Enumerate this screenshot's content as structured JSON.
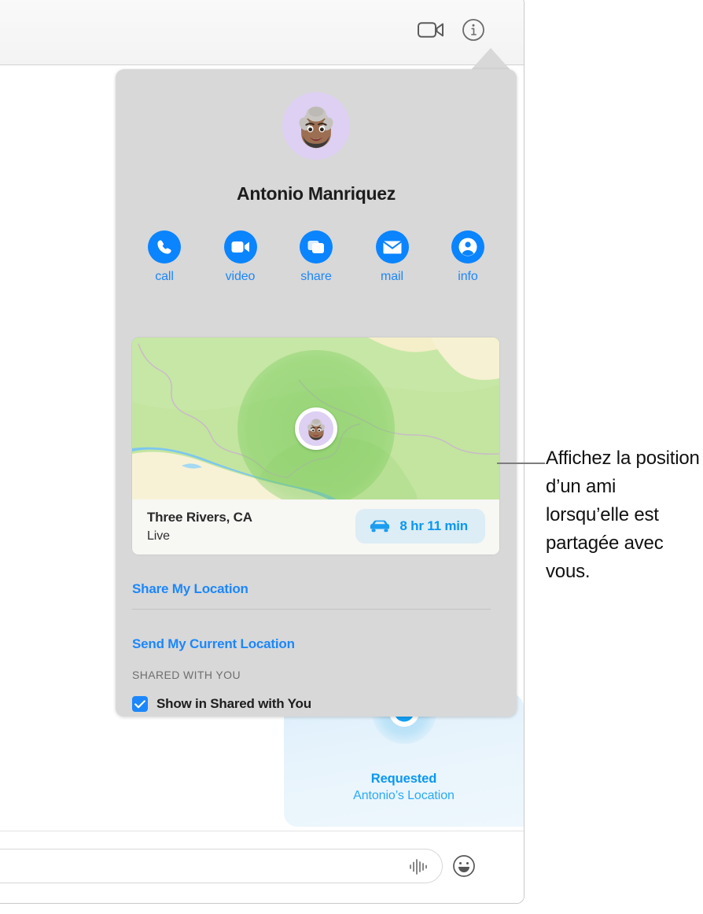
{
  "window": {
    "toolbar": {
      "facetime_icon": "video-camera-icon",
      "details_icon": "info-circle-icon"
    }
  },
  "popover": {
    "contact": {
      "name": "Antonio Manriquez",
      "avatar_icon": "memoji-avatar"
    },
    "actions": [
      {
        "label": "call",
        "icon": "phone-icon"
      },
      {
        "label": "video",
        "icon": "video-camera-icon"
      },
      {
        "label": "share",
        "icon": "screen-share-icon"
      },
      {
        "label": "mail",
        "icon": "envelope-icon"
      },
      {
        "label": "info",
        "icon": "person-circle-icon"
      }
    ],
    "map": {
      "place": "Three Rivers, CA",
      "status": "Live",
      "eta": "8 hr 11 min",
      "eta_icon": "car-icon",
      "pin_icon": "memoji-avatar"
    },
    "links": {
      "share_my_location": "Share My Location",
      "send_current_location": "Send My Current Location"
    },
    "shared_section": {
      "header": "SHARED WITH YOU",
      "checkbox_label": "Show in Shared with You",
      "checkbox_checked": true,
      "check_icon": "checkmark-icon"
    }
  },
  "conversation": {
    "bubble": {
      "title": "Requested",
      "subtitle": "Antonio’s Location",
      "icon": "location-dot-icon"
    },
    "input": {
      "placeholder": "",
      "value": "",
      "audio_icon": "audio-waveform-icon",
      "emoji_icon": "smiley-face-icon"
    }
  },
  "callout": {
    "text": "Affichez la position d’un ami lorsqu’elle est partagée avec vous."
  },
  "colors": {
    "accent_blue": "#0a84ff",
    "link_blue": "#1b87fb",
    "popover_gray": "#d8d8d8",
    "map_green": "#c2e49e",
    "bubble_blue": "#e8f4fc"
  }
}
